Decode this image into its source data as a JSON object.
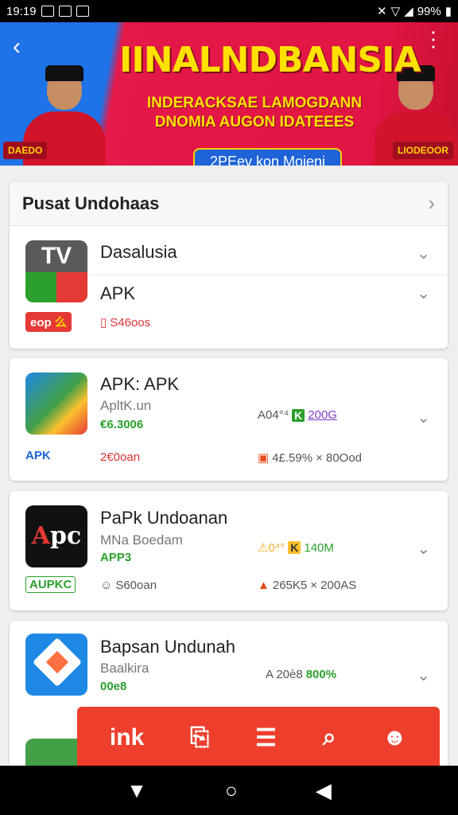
{
  "status": {
    "time": "19:19",
    "battery": "99%"
  },
  "banner": {
    "headline": "IINALNDBANSIA",
    "subline1": "INDERACKSAE LAMOGDANN",
    "subline2": "DNOMIA AUGON IDATEEES",
    "cta": "2PEev kon Moieni",
    "left_tag": "DAEDO",
    "right_tag": "LIODEOOR"
  },
  "section": {
    "title": "Pusat Undohaas"
  },
  "apps": [
    {
      "name": "Dasalusia",
      "name2": "APK",
      "badge": "eop",
      "badge_mark": "么",
      "meta1": "S46oos"
    },
    {
      "name": "APK: APK",
      "dev": "ApltK.un",
      "price": "€6.3006",
      "badge": "APK",
      "meta1": "2€0oan",
      "rating": "A04°⁴",
      "rating_mark": "K",
      "size": "200G",
      "downloads": "4£.59%",
      "downloads2": "× 80Ood"
    },
    {
      "name": "PaPk Undoanan",
      "dev": "MNa Boedam",
      "price": "APP3",
      "badge": "AUPKC",
      "meta1": "S60oan",
      "rating": "⚠0⁴°",
      "rating_mark": "K",
      "size": "140M",
      "downloads": "265K5",
      "downloads2": "× 200AS"
    },
    {
      "name": "Bapsan Undunah",
      "dev": "Baalkira",
      "price": "00e8",
      "rating": "A 20è8",
      "size": "800%"
    }
  ],
  "bottom_bar": {
    "brand": "ink"
  },
  "colors": {
    "accent": "#ee3f2c",
    "banner_blue": "#1e73e8",
    "banner_red": "#e5194a",
    "yellow": "#ffe100"
  }
}
